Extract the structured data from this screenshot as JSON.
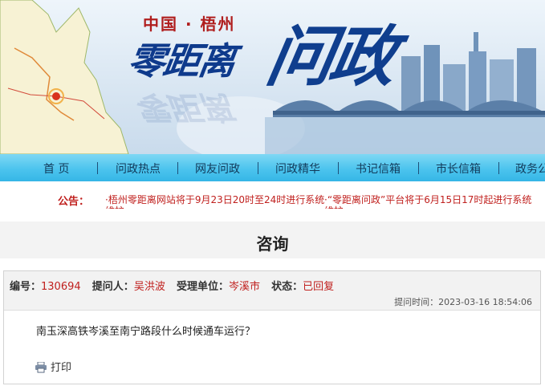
{
  "banner": {
    "subtitle": "中国 · 梧州",
    "title_part1": "零距离",
    "title_part2": "问政",
    "reflection": "零距离"
  },
  "nav": {
    "items": [
      {
        "label": "首  页"
      },
      {
        "label": "问政热点"
      },
      {
        "label": "网友问政"
      },
      {
        "label": "问政精华"
      },
      {
        "label": "书记信箱"
      },
      {
        "label": "市长信箱"
      },
      {
        "label": "政务公"
      }
    ]
  },
  "notice": {
    "label": "公告：",
    "items": [
      {
        "text": "·梧州零距离网站将于9月23日20时至24时进行系统",
        "wrap": "维护"
      },
      {
        "text": "·“零距离问政”平台将于6月15日17时起进行系统",
        "wrap": "维护"
      }
    ]
  },
  "page": {
    "heading": "咨询"
  },
  "consult": {
    "number_label": "编号：",
    "number": "130694",
    "asker_label": "提问人：",
    "asker": "吴洪波",
    "unit_label": "受理单位：",
    "unit": "岑溪市",
    "status_label": "状态：",
    "status": "已回复",
    "time_label": "提问时间：",
    "time": "2023-03-16 18:54:06",
    "question": "南玉深高铁岑溪至南宁路段什么时候通车运行？",
    "print_label": "打印"
  },
  "colors": {
    "accent_red": "#c0201e",
    "nav_blue": "#4cc4ee",
    "title_blue": "#0f3e8e"
  }
}
